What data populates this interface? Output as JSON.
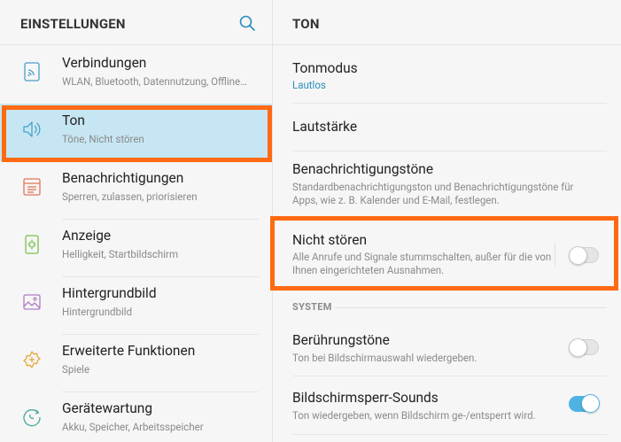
{
  "left_header": {
    "title": "EINSTELLUNGEN"
  },
  "right_header": {
    "title": "TON"
  },
  "nav": [
    {
      "name": "verbindungen",
      "icon": "connections-icon",
      "title": "Verbindungen",
      "subtitle": "WLAN, Bluetooth, Datennutzung, Offline…",
      "selected": false
    },
    {
      "name": "ton",
      "icon": "speaker-icon",
      "title": "Ton",
      "subtitle": "Töne, Nicht stören",
      "selected": true
    },
    {
      "name": "benachrichtigungen",
      "icon": "notifications-icon",
      "title": "Benachrichtigungen",
      "subtitle": "Sperren, zulassen, priorisieren",
      "selected": false
    },
    {
      "name": "anzeige",
      "icon": "display-icon",
      "title": "Anzeige",
      "subtitle": "Helligkeit, Startbildschirm",
      "selected": false
    },
    {
      "name": "hintergrundbild",
      "icon": "wallpaper-icon",
      "title": "Hintergrundbild",
      "subtitle": "Hintergrundbild",
      "selected": false
    },
    {
      "name": "erweiterte-funktionen",
      "icon": "advanced-features-icon",
      "title": "Erweiterte Funktionen",
      "subtitle": "Spiele",
      "selected": false
    },
    {
      "name": "geraetewartung",
      "icon": "device-maintenance-icon",
      "title": "Gerätewartung",
      "subtitle": "Akku, Speicher, Arbeitsspeicher",
      "selected": false
    }
  ],
  "settings": {
    "tonmodus": {
      "title": "Tonmodus",
      "value": "Lautlos"
    },
    "lautstaerke": {
      "title": "Lautstärke"
    },
    "benachrichtigungstoene": {
      "title": "Benachrichtigungstöne",
      "subtitle": "Standardbenachrichtigungston und Benachrichtigungstöne für Apps, wie z. B. Kalender und E-Mail, festlegen."
    },
    "nicht_stoeren": {
      "title": "Nicht stören",
      "subtitle": "Alle Anrufe und Signale stummschalten, außer für die von Ihnen eingerichteten Ausnahmen.",
      "enabled": false
    },
    "section_system": "SYSTEM",
    "beruehrungstoene": {
      "title": "Berührungstöne",
      "subtitle": "Ton bei Bildschirmauswahl wiedergeben.",
      "enabled": false
    },
    "bildschirmsperr_sounds": {
      "title": "Bildschirmsperr-Sounds",
      "subtitle": "Ton wiedergeben, wenn Bildschirm ge-/entsperrt wird.",
      "enabled": true
    }
  },
  "colors": {
    "accent": "#2a8fbd",
    "highlight": "#ff6a13",
    "selected_bg": "#c7e6f3",
    "toggle_on": "#4fb3e1"
  }
}
